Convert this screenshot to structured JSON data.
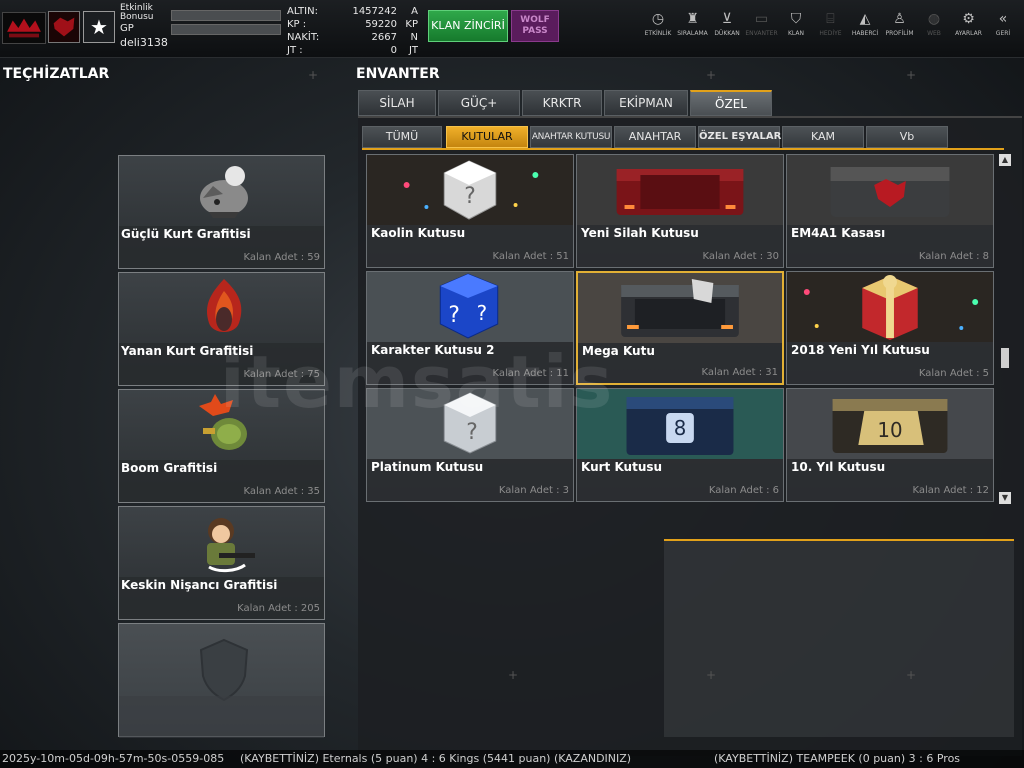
{
  "player": {
    "etkinlik_label": "Etkinlik Bonusu",
    "gp_label": "GP",
    "username": "deli3138"
  },
  "currency": [
    {
      "label": "ALTIN:",
      "value": "1457242",
      "unit": "A"
    },
    {
      "label": "KP :",
      "value": "59220",
      "unit": "KP"
    },
    {
      "label": "NAKİT:",
      "value": "2667",
      "unit": "N"
    },
    {
      "label": "JT :",
      "value": "0",
      "unit": "JT"
    }
  ],
  "buttons": {
    "klan": "KLAN ZİNCİRİ",
    "wolf": "WOLF PASS"
  },
  "nav": [
    {
      "label": "ETKİNLİK",
      "icon": "stopwatch-icon",
      "glyph": "◷",
      "dim": false
    },
    {
      "label": "SIRALAMA",
      "icon": "rank-medal-icon",
      "glyph": "♜",
      "dim": false
    },
    {
      "label": "DÜKKAN",
      "icon": "cart-icon",
      "glyph": "⊻",
      "dim": false
    },
    {
      "label": "ENVANTER",
      "icon": "inventory-icon",
      "glyph": "▭",
      "dim": true
    },
    {
      "label": "KLAN",
      "icon": "clan-shield-icon",
      "glyph": "⛉",
      "dim": false
    },
    {
      "label": "HEDİYE",
      "icon": "gift-icon",
      "glyph": "⌸",
      "dim": true
    },
    {
      "label": "HABERCİ",
      "icon": "megaphone-icon",
      "glyph": "◭",
      "dim": false
    },
    {
      "label": "PROFİLİM",
      "icon": "profile-icon",
      "glyph": "♙",
      "dim": false
    },
    {
      "label": "WEB",
      "icon": "globe-icon",
      "glyph": "◍",
      "dim": true
    },
    {
      "label": "AYARLAR",
      "icon": "gear-icon",
      "glyph": "⚙",
      "dim": false
    },
    {
      "label": "GERİ",
      "icon": "back-chevron-icon",
      "glyph": "«",
      "dim": false
    }
  ],
  "headers": {
    "left": "TEÇHİZATLAR",
    "right": "ENVANTER"
  },
  "equipment": [
    {
      "name": "Güçlü Kurt Grafitisi",
      "count": "Kalan Adet : 59",
      "icon": "wolf-graffiti-icon"
    },
    {
      "name": "Yanan Kurt Grafitisi",
      "count": "Kalan Adet : 75",
      "icon": "burning-wolf-graffiti-icon"
    },
    {
      "name": "Boom Grafitisi",
      "count": "Kalan Adet : 35",
      "icon": "boom-graffiti-icon"
    },
    {
      "name": "Keskin Nişancı Grafitisi",
      "count": "Kalan Adet : 205",
      "icon": "sniper-graffiti-icon"
    }
  ],
  "tabs_main": [
    "SİLAH",
    "GÜÇ+",
    "KRKTR",
    "EKİPMAN",
    "ÖZEL"
  ],
  "tabs_main_active": 4,
  "tabs_sub": [
    "TÜMÜ",
    "KUTULAR",
    "ANAHTAR KUTUSU",
    "ANAHTAR",
    "ÖZEL EŞYALAR",
    "KAM",
    "Vb"
  ],
  "tabs_sub_active": 1,
  "items": [
    {
      "name": "Kaolin Kutusu",
      "count": "Kalan Adet : 51",
      "kind": "mystery-white",
      "selected": false
    },
    {
      "name": "Yeni Silah Kutusu",
      "count": "Kalan Adet : 30",
      "kind": "crate-red",
      "selected": false
    },
    {
      "name": "EM4A1 Kasası",
      "count": "Kalan Adet : 8",
      "kind": "crate-dark",
      "selected": false
    },
    {
      "name": "Karakter Kutusu 2",
      "count": "Kalan Adet : 11",
      "kind": "mystery-blue",
      "selected": false
    },
    {
      "name": "Mega Kutu",
      "count": "Kalan Adet : 31",
      "kind": "crate-steel",
      "selected": true
    },
    {
      "name": "2018 Yeni Yıl Kutusu",
      "count": "Kalan Adet : 5",
      "kind": "gift-box",
      "selected": false
    },
    {
      "name": "Platinum Kutusu",
      "count": "Kalan Adet : 3",
      "kind": "mystery-silver",
      "selected": false
    },
    {
      "name": "Kurt Kutusu",
      "count": "Kalan Adet : 6",
      "kind": "crate-wolf",
      "selected": false
    },
    {
      "name": "10. Yıl Kutusu",
      "count": "Kalan Adet : 12",
      "kind": "crate-gold",
      "selected": false
    }
  ],
  "ticker": {
    "left": "2025y-10m-05d-09h-57m-50s-0559-085",
    "mid": "(KAYBETTİNİZ) Eternals (5 puan) 4 : 6 Kings (5441 puan) (KAZANDINIZ)",
    "right": "(KAYBETTİNİZ) TEAMPEEK (0 puan) 3 : 6 Pros"
  },
  "watermark": "itemsatis"
}
